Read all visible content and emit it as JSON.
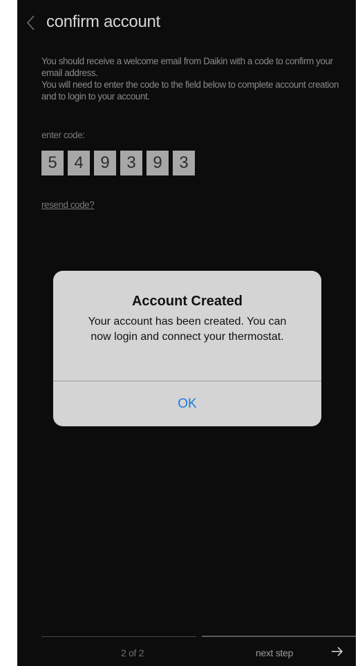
{
  "header": {
    "title": "confirm account",
    "back_icon": "chevron-left-icon"
  },
  "instructions": {
    "line1": "You should receive a welcome email from Daikin with a code to confirm your email address.",
    "line2": "You will need to enter the code to the field below to complete account creation and to login to your account."
  },
  "code_entry": {
    "label": "enter code:",
    "digits": [
      "5",
      "4",
      "9",
      "3",
      "9",
      "3"
    ]
  },
  "resend_link": "resend code?",
  "footer": {
    "step_text": "2 of 2",
    "next_label": "next step",
    "next_icon": "arrow-right-icon"
  },
  "alert": {
    "title": "Account Created",
    "message": "Your account has been created.  You can now login and connect your thermostat.",
    "ok_label": "OK"
  },
  "colors": {
    "background": "#0c0c0c",
    "code_box": "#a7a7a7",
    "alert_background": "#d4d4d4",
    "alert_button": "#1f7ae0"
  }
}
